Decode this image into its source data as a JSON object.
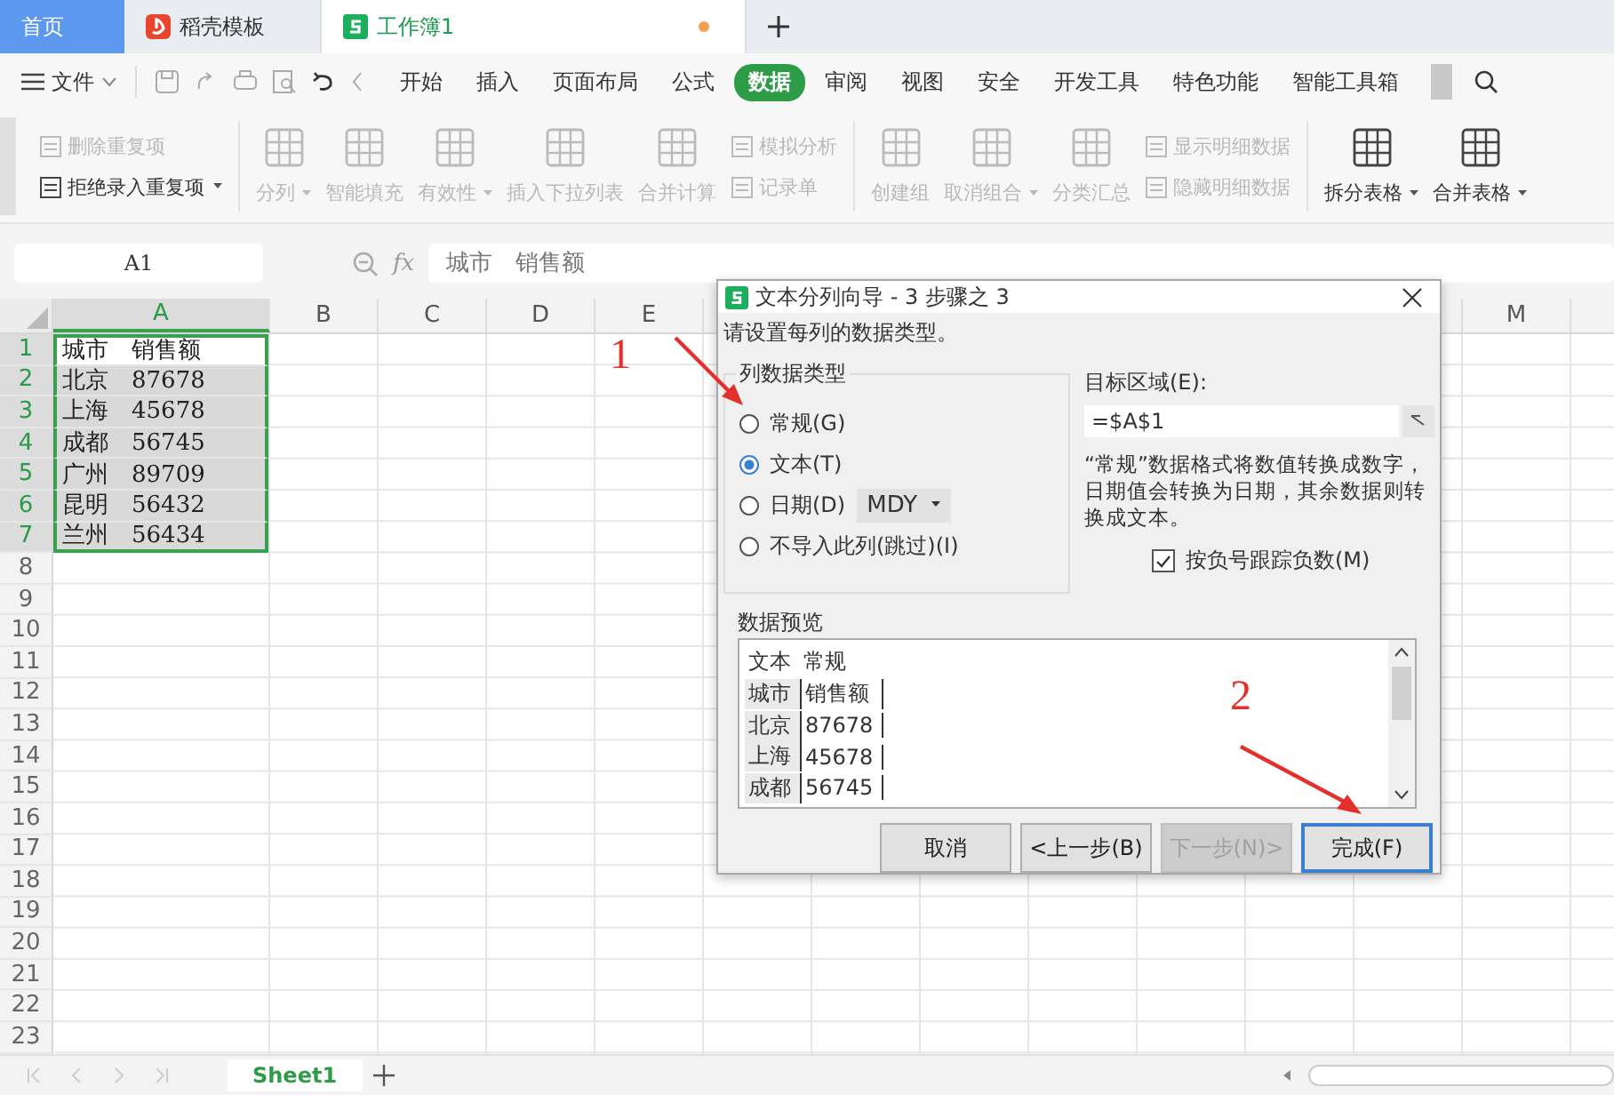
{
  "window_tabs": [
    {
      "label": "首页",
      "kind": "home",
      "selected": false,
      "modified": false
    },
    {
      "label": "稻壳模板",
      "kind": "template",
      "selected": false,
      "modified": false
    },
    {
      "label": "工作簿1",
      "kind": "workbook",
      "selected": true,
      "modified": true
    }
  ],
  "menu": {
    "file_label": "文件",
    "tabs": [
      {
        "label": "开始",
        "selected": false
      },
      {
        "label": "插入",
        "selected": false
      },
      {
        "label": "页面布局",
        "selected": false
      },
      {
        "label": "公式",
        "selected": false
      },
      {
        "label": "数据",
        "selected": true
      },
      {
        "label": "审阅",
        "selected": false
      },
      {
        "label": "视图",
        "selected": false
      },
      {
        "label": "安全",
        "selected": false
      },
      {
        "label": "开发工具",
        "selected": false
      },
      {
        "label": "特色功能",
        "selected": false
      },
      {
        "label": "智能工具箱",
        "selected": false
      }
    ]
  },
  "ribbon": {
    "sections": [
      [
        {
          "kind": "stack",
          "items": [
            {
              "label": "删除重复项",
              "disabled": true,
              "dropdown": false
            },
            {
              "label": "拒绝录入重复项",
              "disabled": false,
              "dropdown": true
            }
          ]
        }
      ],
      [
        {
          "kind": "large",
          "label": "分列",
          "disabled": true,
          "dropdown": true
        },
        {
          "kind": "large",
          "label": "智能填充",
          "disabled": true,
          "dropdown": false
        },
        {
          "kind": "large",
          "label": "有效性",
          "disabled": true,
          "dropdown": true
        },
        {
          "kind": "large",
          "label": "插入下拉列表",
          "disabled": true,
          "dropdown": false
        },
        {
          "kind": "large",
          "label": "合并计算",
          "disabled": true,
          "dropdown": false
        },
        {
          "kind": "stack",
          "items": [
            {
              "label": "模拟分析",
              "disabled": true,
              "dropdown": false
            },
            {
              "label": "记录单",
              "disabled": true,
              "dropdown": false
            }
          ]
        }
      ],
      [
        {
          "kind": "large",
          "label": "创建组",
          "disabled": true,
          "dropdown": false
        },
        {
          "kind": "large",
          "label": "取消组合",
          "disabled": true,
          "dropdown": true
        },
        {
          "kind": "large",
          "label": "分类汇总",
          "disabled": true,
          "dropdown": false
        },
        {
          "kind": "stack",
          "items": [
            {
              "label": "显示明细数据",
              "disabled": true,
              "dropdown": false
            },
            {
              "label": "隐藏明细数据",
              "disabled": true,
              "dropdown": false
            }
          ]
        }
      ],
      [
        {
          "kind": "large",
          "label": "拆分表格",
          "disabled": false,
          "dropdown": true
        },
        {
          "kind": "large",
          "label": "合并表格",
          "disabled": false,
          "dropdown": true
        }
      ]
    ]
  },
  "formula_bar": {
    "name_box": "A1",
    "fx": "fx",
    "value": "城市　销售额"
  },
  "sheet": {
    "columns": [
      {
        "label": "A",
        "selected": true
      },
      {
        "label": "B",
        "selected": false
      },
      {
        "label": "C",
        "selected": false
      },
      {
        "label": "D",
        "selected": false
      },
      {
        "label": "E",
        "selected": false
      },
      {
        "label": "M",
        "selected": false
      }
    ],
    "rows": [
      {
        "number": "1",
        "selected": true,
        "active": true,
        "cell": "城市　销售额"
      },
      {
        "number": "2",
        "selected": true,
        "active": false,
        "cell": "北京　87678"
      },
      {
        "number": "3",
        "selected": true,
        "active": false,
        "cell": "上海　45678"
      },
      {
        "number": "4",
        "selected": true,
        "active": false,
        "cell": "成都　56745"
      },
      {
        "number": "5",
        "selected": true,
        "active": false,
        "cell": "广州　89709"
      },
      {
        "number": "6",
        "selected": true,
        "active": false,
        "cell": "昆明　56432"
      },
      {
        "number": "7",
        "selected": true,
        "active": false,
        "cell": "兰州　56434"
      },
      {
        "number": "8",
        "selected": false
      },
      {
        "number": "9",
        "selected": false
      },
      {
        "number": "10",
        "selected": false
      },
      {
        "number": "11",
        "selected": false
      },
      {
        "number": "12",
        "selected": false
      },
      {
        "number": "13",
        "selected": false
      },
      {
        "number": "14",
        "selected": false
      },
      {
        "number": "15",
        "selected": false
      },
      {
        "number": "16",
        "selected": false
      },
      {
        "number": "17",
        "selected": false
      },
      {
        "number": "18",
        "selected": false
      },
      {
        "number": "19",
        "selected": false
      },
      {
        "number": "20",
        "selected": false
      },
      {
        "number": "21",
        "selected": false
      },
      {
        "number": "22",
        "selected": false
      },
      {
        "number": "23",
        "selected": false
      }
    ],
    "sheet_tabs": [
      {
        "label": "Sheet1",
        "selected": true
      }
    ]
  },
  "dialog": {
    "title": "文本分列向导 - 3 步骤之 3",
    "instruction": "请设置每列的数据类型。",
    "group_label": "列数据类型",
    "options": [
      {
        "label": "常规(G)",
        "selected": false
      },
      {
        "label": "文本(T)",
        "selected": true
      },
      {
        "label": "日期(D)",
        "selected": false,
        "dropdown": "MDY"
      },
      {
        "label": "不导入此列(跳过)(I)",
        "selected": false
      }
    ],
    "target_label": "目标区域(E):",
    "target_value": "=$A$1",
    "note": "“常规”数据格式将数值转换成数字，日期值会转换为日期，其余数据则转换成文本。",
    "checkbox": {
      "label": "按负号跟踪负数(M)",
      "checked": true
    },
    "preview_label": "数据预览",
    "preview": {
      "headers": [
        "文本",
        "常规"
      ],
      "rows": [
        [
          "城市",
          "销售额"
        ],
        [
          "北京",
          "87678"
        ],
        [
          "上海",
          "45678"
        ],
        [
          "成都",
          "56745"
        ]
      ]
    },
    "buttons": [
      {
        "label": "取消",
        "disabled": false,
        "default": false
      },
      {
        "label": "<上一步(B)",
        "disabled": false,
        "default": false
      },
      {
        "label": "下一步(N)>",
        "disabled": true,
        "default": false
      },
      {
        "label": "完成(F)",
        "disabled": false,
        "default": true
      }
    ]
  },
  "annotations": [
    {
      "label": "1"
    },
    {
      "label": "2"
    }
  ]
}
